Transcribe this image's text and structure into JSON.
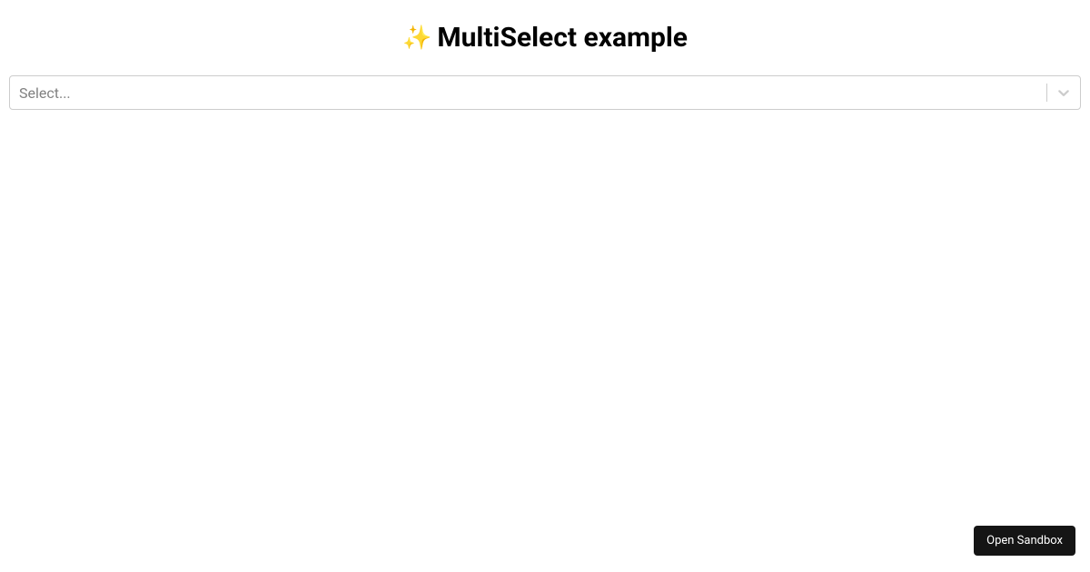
{
  "header": {
    "icon_name": "sparkle-icon",
    "icon_glyph": "✨",
    "title": "MultiSelect example"
  },
  "select": {
    "placeholder": "Select...",
    "indicator_icon_name": "chevron-down-icon"
  },
  "footer": {
    "open_sandbox_label": "Open Sandbox"
  },
  "colors": {
    "border": "#cccccc",
    "placeholder": "#808080",
    "button_bg": "#151515",
    "button_fg": "#ffffff"
  }
}
